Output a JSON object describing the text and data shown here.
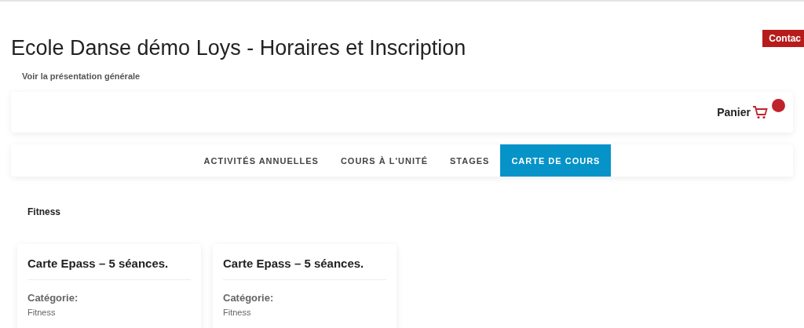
{
  "header": {
    "title": "Ecole Danse démo Loys - Horaires et Inscription",
    "link": "Voir la présentation générale",
    "contact_button": "Contac"
  },
  "cart": {
    "label": "Panier"
  },
  "tabs": [
    {
      "label": "ACTIVITÉS ANNUELLES",
      "selected": false
    },
    {
      "label": "COURS À L'UNITÉ",
      "selected": false
    },
    {
      "label": "STAGES",
      "selected": false
    },
    {
      "label": "CARTE DE COURS",
      "selected": true
    }
  ],
  "section": {
    "title": "Fitness"
  },
  "cards": [
    {
      "title": "Carte Epass – 5 séances.",
      "field_label": "Catégorie:",
      "field_value": "Fitness"
    },
    {
      "title": "Carte Epass – 5 séances.",
      "field_label": "Catégorie:",
      "field_value": "Fitness"
    }
  ]
}
